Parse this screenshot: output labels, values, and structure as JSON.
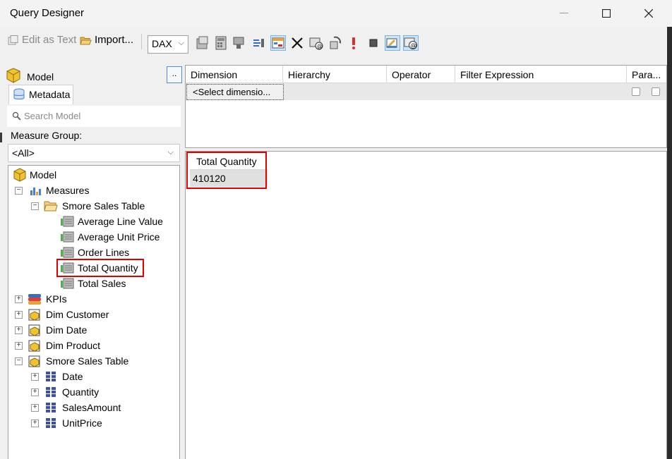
{
  "window": {
    "title": "Query Designer"
  },
  "toolbar": {
    "edit_as_text": "Edit as Text",
    "import": "Import...",
    "query_language": "DAX"
  },
  "metadata_pane": {
    "model_label": "Model",
    "dots_button": "..",
    "tab_label": "Metadata",
    "search_placeholder": "Search Model",
    "measure_group_label": "Measure Group:",
    "measure_group_value": "<All>"
  },
  "tree": {
    "root": "Model",
    "measures": "Measures",
    "sales_table_folder": "Smore Sales Table",
    "measure_items": [
      "Average Line Value",
      "Average Unit Price",
      "Order Lines",
      "Total Quantity",
      "Total Sales"
    ],
    "kpis": "KPIs",
    "dimensions": [
      "Dim Customer",
      "Dim Date",
      "Dim Product",
      "Smore Sales Table"
    ],
    "sales_table_columns": [
      "Date",
      "Quantity",
      "SalesAmount",
      "UnitPrice"
    ]
  },
  "filter_grid": {
    "columns": [
      "Dimension",
      "Hierarchy",
      "Operator",
      "Filter Expression",
      "Para..."
    ],
    "select_dimension": "<Select dimensio..."
  },
  "results": {
    "column_header": "Total Quantity",
    "value": "410120"
  },
  "colors": {
    "highlight": "#e00000",
    "accent": "#4b8fd9"
  }
}
